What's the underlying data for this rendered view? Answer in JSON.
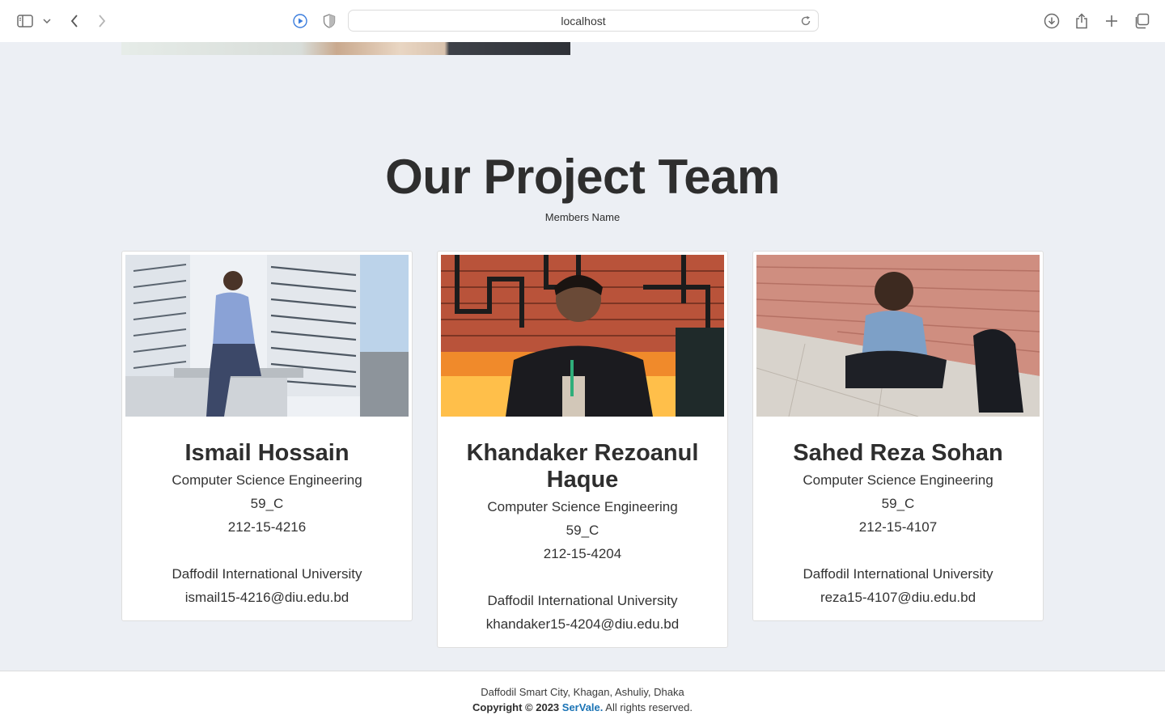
{
  "browser": {
    "url": "localhost",
    "icons": [
      "sidebar-icon",
      "chevron-down-icon",
      "back-icon",
      "forward-icon",
      "media-play-icon",
      "shield-icon",
      "reload-icon",
      "download-icon",
      "share-icon",
      "new-tab-icon",
      "tabs-overview-icon"
    ]
  },
  "section": {
    "title": "Our Project Team",
    "subtitle": "Members Name"
  },
  "members": [
    {
      "name": "Ismail Hossain",
      "department": "Computer Science Engineering",
      "batch": "59_C",
      "id": "212-15-4216",
      "university": "Daffodil International University",
      "email": "ismail15-4216@diu.edu.bd"
    },
    {
      "name": "Khandaker Rezoanul Haque",
      "department": "Computer Science Engineering",
      "batch": "59_C",
      "id": "212-15-4204",
      "university": "Daffodil International University",
      "email": "khandaker15-4204@diu.edu.bd"
    },
    {
      "name": "Sahed Reza Sohan",
      "department": "Computer Science Engineering",
      "batch": "59_C",
      "id": "212-15-4107",
      "university": "Daffodil International University",
      "email": "reza15-4107@diu.edu.bd"
    }
  ],
  "footer": {
    "address": "Daffodil Smart City, Khagan, Ashuliy, Dhaka",
    "copyright_prefix": "Copyright © 2023",
    "brand": "SerVale.",
    "rights": "All rights reserved."
  },
  "colors": {
    "page_bg": "#eceff4",
    "brand_link": "#1a73b5",
    "media_icon": "#3b7ddd"
  }
}
